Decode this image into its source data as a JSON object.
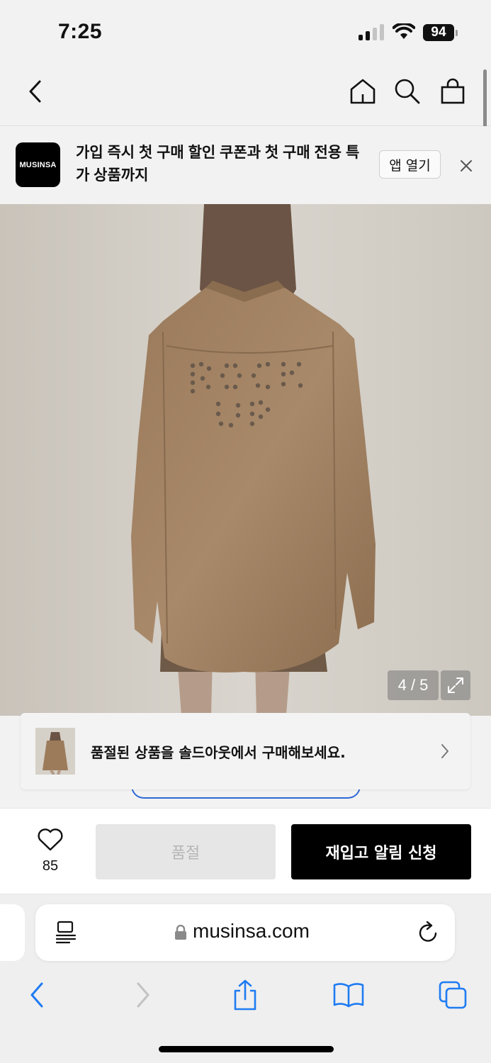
{
  "status_bar": {
    "time": "7:25",
    "battery": "94"
  },
  "promo": {
    "logo": "MUSINSA",
    "text": "가입 즉시 첫 구매 할인 쿠폰과 첫 구매 전용 특가 상품까지",
    "open_label": "앱 열기"
  },
  "gallery": {
    "counter": "4 / 5"
  },
  "soldout_card": {
    "text": "품절된 상품을 솔드아웃에서 구매해보세요."
  },
  "actions": {
    "like_count": "85",
    "soldout_label": "품절",
    "restock_label": "재입고 알림 신청"
  },
  "browser": {
    "url": "musinsa.com"
  },
  "colors": {
    "accent_blue": "#2e68d8",
    "primary_black": "#000000",
    "disabled_gray": "#e6e6e6",
    "ios_blue": "#1f7cf2"
  },
  "icons": [
    "back-icon",
    "home-icon",
    "search-icon",
    "bag-icon",
    "close-icon",
    "expand-icon",
    "chevron-right-icon",
    "heart-icon",
    "reader-icon",
    "lock-icon",
    "reload-icon",
    "share-icon",
    "bookmarks-icon",
    "tabs-icon"
  ]
}
